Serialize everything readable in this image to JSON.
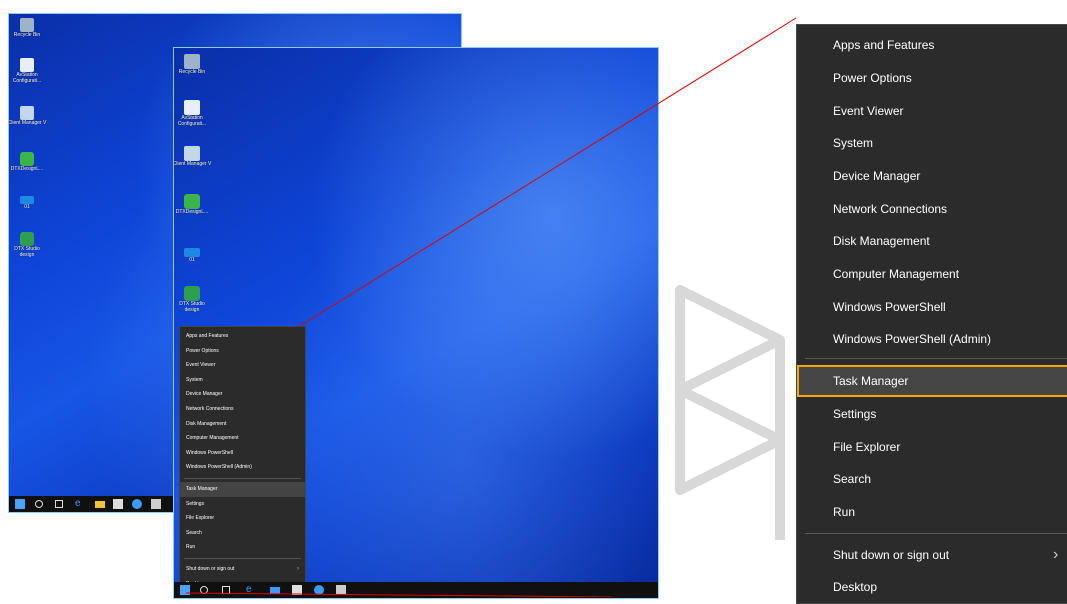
{
  "desktop_icons_back": [
    {
      "label": "Recycle Bin"
    },
    {
      "label": "AvStation Configurati..."
    },
    {
      "label": "Client Manager V"
    },
    {
      "label": "DTXDesignL..."
    },
    {
      "label": "01"
    },
    {
      "label": "DTX Studio design"
    }
  ],
  "desktop_icons_front": [
    {
      "label": "Recycle Bin"
    },
    {
      "label": "AvStation Configurati..."
    },
    {
      "label": "Client Manager V"
    },
    {
      "label": "DTXDesignL..."
    },
    {
      "label": "01"
    },
    {
      "label": "DTX Studio design"
    }
  ],
  "context_menu": {
    "items": [
      "Apps and Features",
      "Power Options",
      "Event Viewer",
      "System",
      "Device Manager",
      "Network Connections",
      "Disk Management",
      "Computer Management",
      "Windows PowerShell",
      "Windows PowerShell (Admin)",
      "Task Manager",
      "Settings",
      "File Explorer",
      "Search",
      "Run",
      "Shut down or sign out",
      "Desktop"
    ],
    "selected": "Task Manager"
  },
  "colors": {
    "highlight": "#f2a900",
    "menu_bg": "#2b2b2b",
    "callout_line": "#e00000",
    "desktop_blue": "#0e45d8"
  },
  "icons": {
    "submenu": "chevron-right-icon",
    "taskbar": [
      "start-icon",
      "search-icon",
      "task-view-icon",
      "edge-icon",
      "file-explorer-icon",
      "store-icon",
      "app-icon",
      "app-icon-2"
    ]
  }
}
